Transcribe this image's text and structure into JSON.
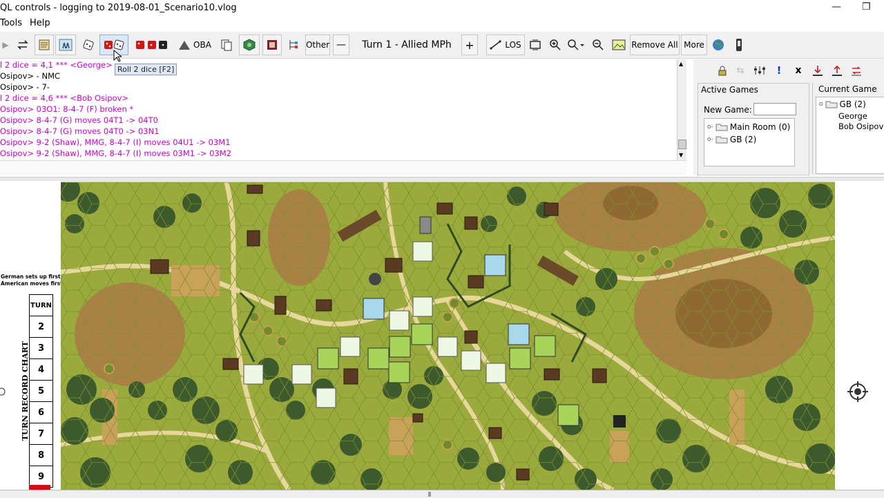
{
  "window": {
    "title": "QL controls - logging to 2019-08-01_Scenario10.vlog",
    "minimize": "—",
    "restore": "❐"
  },
  "menu": {
    "tools": "Tools",
    "help": "Help"
  },
  "toolbar": {
    "oba_label": "OBA",
    "other_label": "Other",
    "turn_label": "Turn 1 - Allied MPh",
    "minus": "—",
    "plus": "+",
    "los_label": "LOS",
    "remove_all_label": "Remove All",
    "more_label": "More"
  },
  "tooltip": "Roll 2 dice [F2]",
  "chat": [
    {
      "text": "l 2 dice = 4,1 *** <George>",
      "color": "#cc00cc"
    },
    {
      "text": "Osipov> - NMC",
      "color": "#000000"
    },
    {
      "text": "Osipov> - 7-",
      "color": "#000000"
    },
    {
      "text": "l 2 dice = 4,6 *** <Bob Osipov>",
      "color": "#cc00cc"
    },
    {
      "text": " Osipov> 03O1: 8-4-7 (F) broken *",
      "color": "#cc00cc"
    },
    {
      "text": " Osipov> 8-4-7 (G) moves 04T1 -> 04T0",
      "color": "#cc00cc"
    },
    {
      "text": " Osipov> 8-4-7 (G) moves 04T0 -> 03N1",
      "color": "#cc00cc"
    },
    {
      "text": " Osipov> 9-2 (Shaw), MMG, 8-4-7 (I) moves 04U1 -> 03M1",
      "color": "#cc00cc"
    },
    {
      "text": " Osipov> 9-2 (Shaw), MMG, 8-4-7 (I) moves 03M1 -> 03M2",
      "color": "#cc00cc"
    }
  ],
  "server": {
    "active_games_title": "Active Games",
    "new_game_label": "New Game:",
    "new_game_value": "",
    "rooms": [
      "Main Room (0)",
      "GB (2)"
    ],
    "current_game_title": "Current Game",
    "current_game_name": "GB (2)",
    "players": [
      "George",
      "Bob Osipov"
    ],
    "exclaim": "!",
    "close": "x"
  },
  "map_side": {
    "setup_line1": "German sets up first",
    "setup_line2": "American moves first",
    "turn_header": "TURN",
    "chart_label": "TURN RECORD CHART",
    "turns": [
      "2",
      "3",
      "4",
      "5",
      "6",
      "7",
      "8",
      "9"
    ]
  },
  "colors": {
    "magenta": "#cc00cc",
    "grass": "#9aaa3c",
    "road": "#e7d79a",
    "woods": "#3d5a2c",
    "hill": "#a27a42",
    "counter_green": "#a8d45a",
    "counter_blue": "#a8d8ea"
  }
}
